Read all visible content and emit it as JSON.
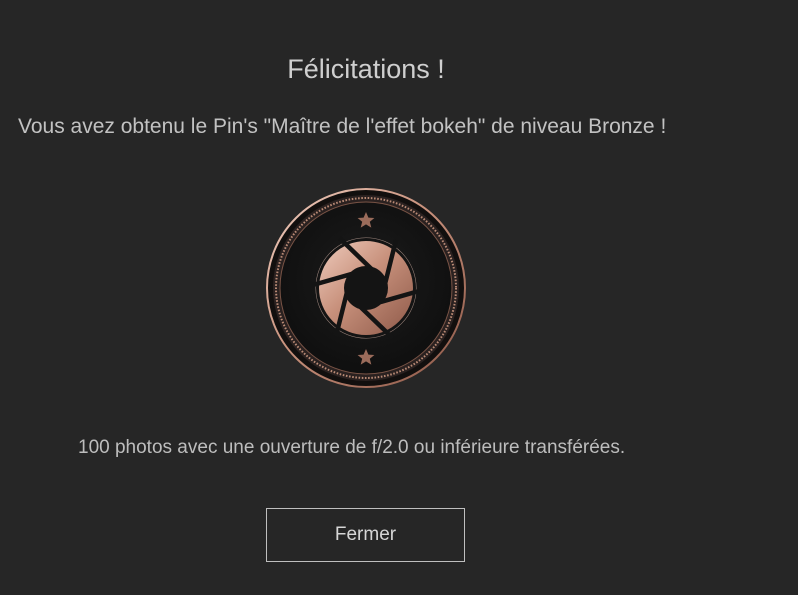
{
  "dialog": {
    "title": "Félicitations !",
    "message": "Vous avez obtenu le Pin's \"Maître de l'effet bokeh\" de niveau Bronze !",
    "description": "100 photos avec une ouverture de f/2.0 ou inférieure transférées.",
    "close_label": "Fermer"
  },
  "badge": {
    "icon": "aperture-icon",
    "decorations": [
      "star-icon",
      "star-icon"
    ],
    "level_color": "#b98a75",
    "background_color": "#262626"
  }
}
